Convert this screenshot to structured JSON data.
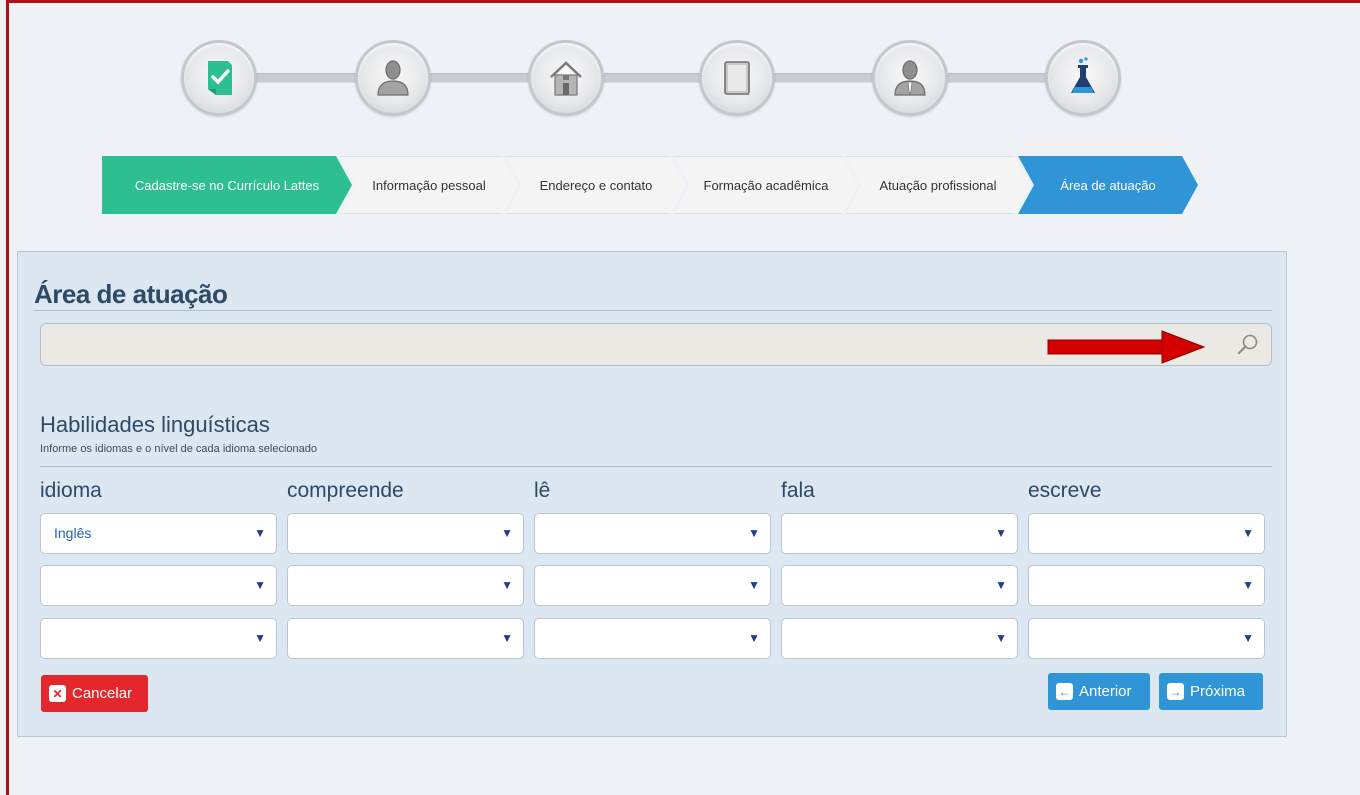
{
  "steps": [
    {
      "icon": "checklist-document-icon"
    },
    {
      "icon": "person-icon"
    },
    {
      "icon": "house-icon"
    },
    {
      "icon": "book-icon"
    },
    {
      "icon": "person-with-tie-icon"
    },
    {
      "icon": "lab-flask-icon"
    }
  ],
  "breadcrumb": [
    {
      "label": "Cadastre-se no Currículo Lattes",
      "state": "done"
    },
    {
      "label": "Informação pessoal",
      "state": "pending"
    },
    {
      "label": "Endereço e contato",
      "state": "pending"
    },
    {
      "label": "Formação acadêmica",
      "state": "pending"
    },
    {
      "label": "Atuação profissional",
      "state": "pending"
    },
    {
      "label": "Área de atuação",
      "state": "active"
    }
  ],
  "panel": {
    "title": "Área de atuação",
    "search": {
      "value": "",
      "placeholder": ""
    }
  },
  "languages": {
    "title": "Habilidades linguísticas",
    "subtitle": "Informe os idiomas e o nível de cada idioma selecionado",
    "columns": [
      "idioma",
      "compreende",
      "lê",
      "fala",
      "escreve"
    ],
    "rows": [
      [
        "Inglês",
        "",
        "",
        "",
        ""
      ],
      [
        "",
        "",
        "",
        "",
        ""
      ],
      [
        "",
        "",
        "",
        "",
        ""
      ]
    ]
  },
  "buttons": {
    "cancel": "Cancelar",
    "previous": "Anterior",
    "next": "Próxima"
  },
  "colors": {
    "step_done": "#2dbf8f",
    "step_active": "#2f95d6",
    "cancel": "#e3272c",
    "annotation_arrow": "#d40000"
  }
}
